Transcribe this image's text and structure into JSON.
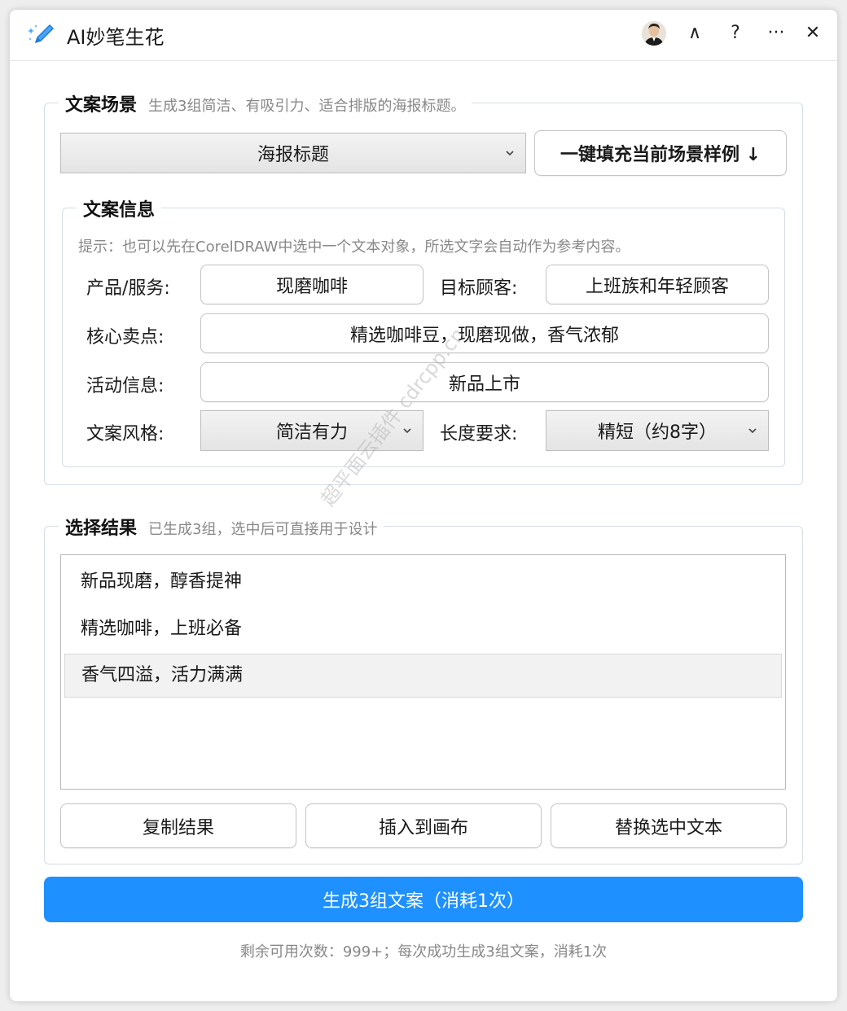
{
  "app": {
    "title": "AI妙笔生花"
  },
  "titlebar": {
    "collapse": "∧",
    "help": "?",
    "more": "···",
    "close": "✕"
  },
  "scene": {
    "legend": "文案场景",
    "subtitle": "生成3组简洁、有吸引力、适合排版的海报标题。",
    "selected": "海报标题",
    "fill_button": "一键填充当前场景样例 ↓"
  },
  "info": {
    "legend": "文案信息",
    "hint": "提示：也可以先在CorelDRAW中选中一个文本对象，所选文字会自动作为参考内容。",
    "product_label": "产品/服务:",
    "product_value": "现磨咖啡",
    "audience_label": "目标顾客:",
    "audience_value": "上班族和年轻顾客",
    "selling_label": "核心卖点:",
    "selling_value": "精选咖啡豆，现磨现做，香气浓郁",
    "event_label": "活动信息:",
    "event_value": "新品上市",
    "style_label": "文案风格:",
    "style_value": "简洁有力",
    "length_label": "长度要求:",
    "length_value": "精短（约8字）"
  },
  "results": {
    "legend": "选择结果",
    "subtitle": "已生成3组，选中后可直接用于设计",
    "items": [
      "新品现磨，醇香提神",
      "精选咖啡，上班必备",
      "香气四溢，活力满满"
    ],
    "selected_index": 2,
    "copy_button": "复制结果",
    "insert_button": "插入到画布",
    "replace_button": "替换选中文本"
  },
  "generate_button": "生成3组文案（消耗1次）",
  "footer": "剩余可用次数：999+；每次成功生成3组文案，消耗1次",
  "watermark": "超平面云插件 cdrcpp.cn",
  "colors": {
    "primary": "#1e90ff",
    "border": "#d5dde6",
    "muted": "#888888"
  }
}
